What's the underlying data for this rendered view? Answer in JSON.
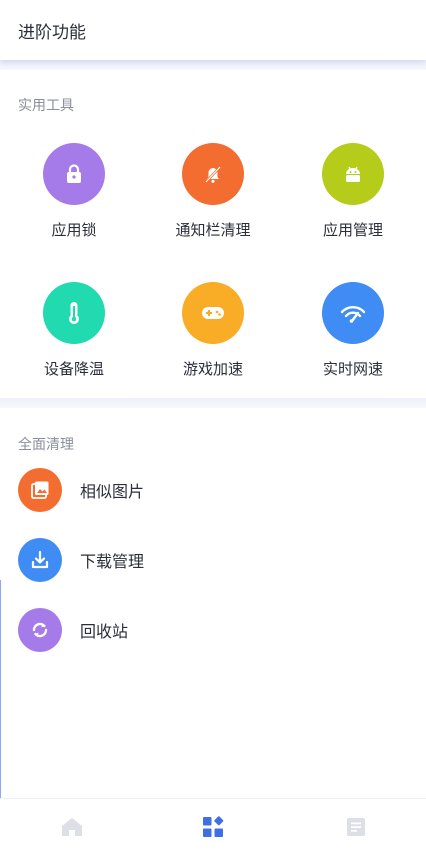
{
  "header": {
    "title": "进阶功能"
  },
  "tools_section": {
    "label": "实用工具",
    "items": [
      {
        "label": "应用锁",
        "icon": "lock-icon",
        "color": "#a57ae9"
      },
      {
        "label": "通知栏清理",
        "icon": "bell-off-icon",
        "color": "#f26d2f"
      },
      {
        "label": "应用管理",
        "icon": "android-icon",
        "color": "#b6cc1a"
      },
      {
        "label": "设备降温",
        "icon": "thermometer-icon",
        "color": "#21dab0"
      },
      {
        "label": "游戏加速",
        "icon": "gamepad-icon",
        "color": "#f9ac25"
      },
      {
        "label": "实时网速",
        "icon": "speed-wifi-icon",
        "color": "#3f8cf4"
      }
    ]
  },
  "clean_section": {
    "label": "全面清理",
    "items": [
      {
        "label": "相似图片",
        "icon": "photos-icon",
        "color": "#f26d2f"
      },
      {
        "label": "下载管理",
        "icon": "download-icon",
        "color": "#3f8cf4"
      },
      {
        "label": "回收站",
        "icon": "recycle-icon",
        "color": "#a57ae9"
      }
    ]
  },
  "bottom_nav": {
    "items": [
      {
        "icon": "home-icon",
        "active": false
      },
      {
        "icon": "apps-icon",
        "active": true
      },
      {
        "icon": "document-icon",
        "active": false
      }
    ],
    "active_color": "#3f6fe6",
    "inactive_color": "#dcdfe6"
  }
}
